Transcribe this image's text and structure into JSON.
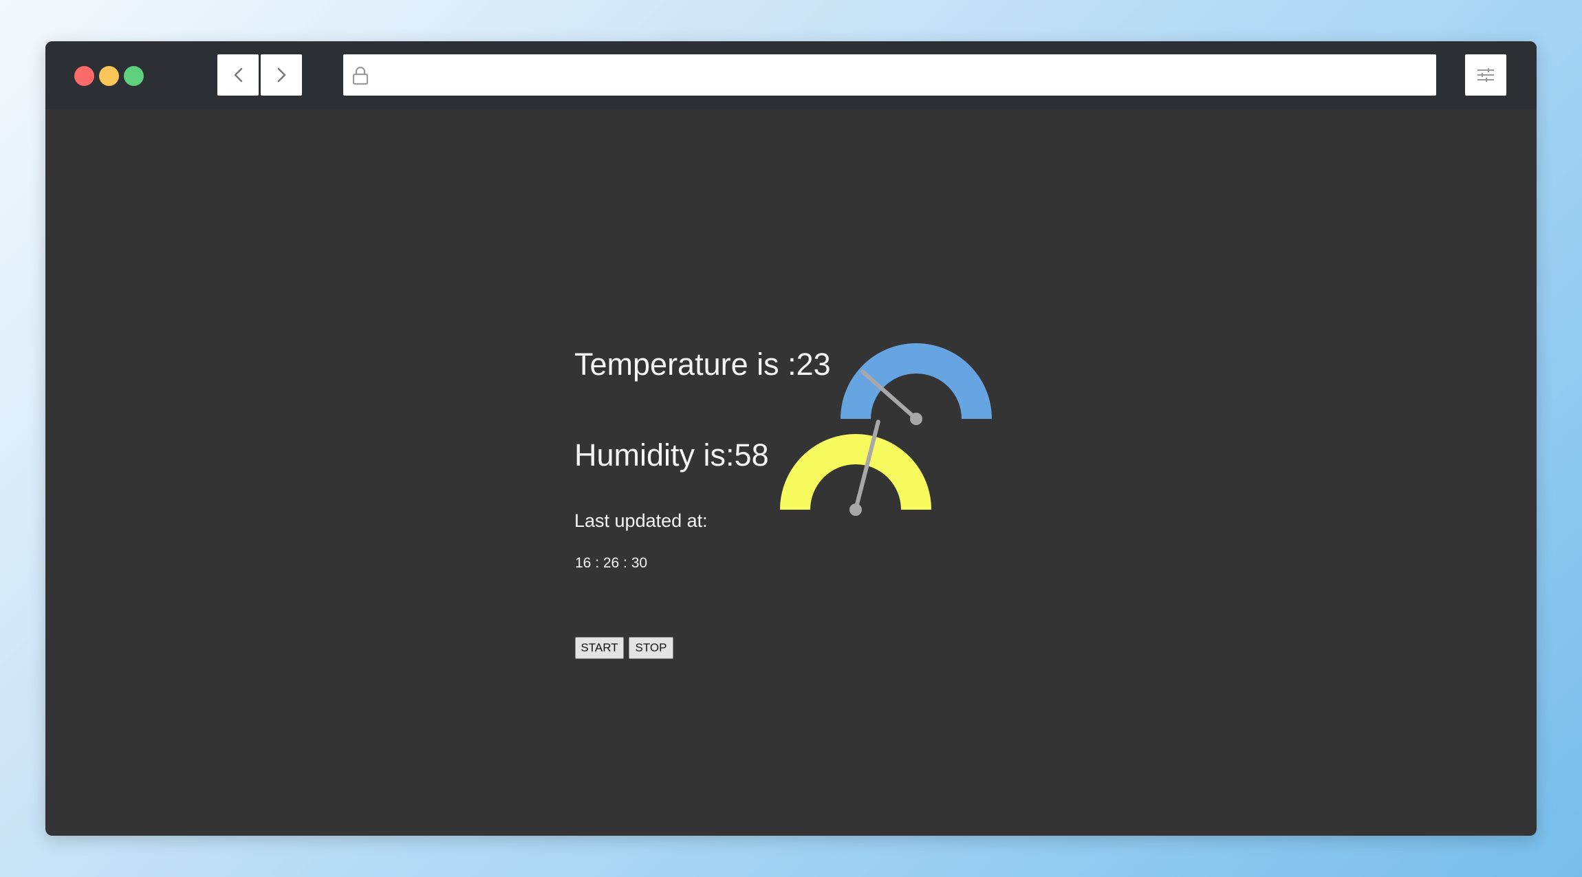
{
  "browser": {
    "traffic_lights": [
      {
        "name": "close",
        "color": "#fc6a6a"
      },
      {
        "name": "minimize",
        "color": "#fdc658"
      },
      {
        "name": "zoom",
        "color": "#5fd07d"
      }
    ],
    "back_icon": "chevron-left-icon",
    "forward_icon": "chevron-right-icon",
    "url": "",
    "lock_icon": "lock-icon",
    "menu_icon": "sliders-icon"
  },
  "dashboard": {
    "temperature": {
      "label": "Temperature is :23",
      "value": 23,
      "gauge_color": "#66a4e2",
      "needle_color": "#a8a8a8"
    },
    "humidity": {
      "label": "Humidity is:58",
      "value": 58,
      "gauge_color": "#f7fb5e",
      "needle_color": "#a8a8a8"
    },
    "last_updated_label": "Last updated at:",
    "last_updated_time": "16 : 26 : 30",
    "buttons": {
      "start": "START",
      "stop": "STOP"
    }
  }
}
